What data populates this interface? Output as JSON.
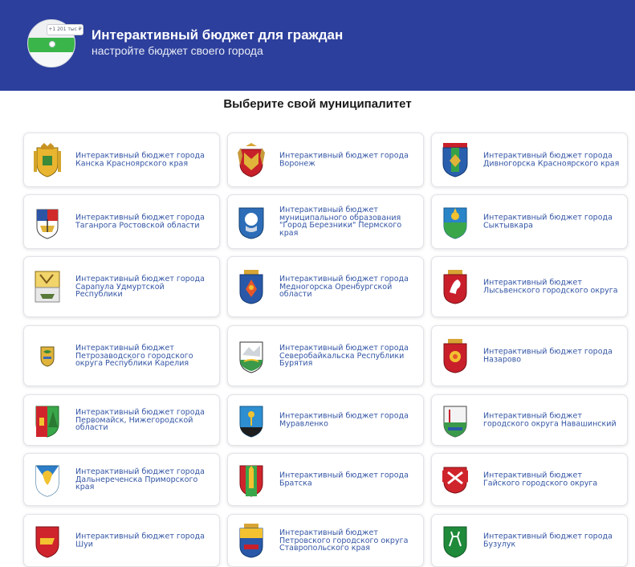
{
  "header": {
    "logo_counter": "+1 201 тыс ₽",
    "title": "Интерактивный бюджет для граждан",
    "subtitle": "настройте бюджет своего города"
  },
  "main": {
    "heading": "Выберите свой муниципалитет",
    "cards": [
      {
        "label": "Интерактивный бюджет города Канска Красноярского края",
        "crest": "kansk-crest-icon"
      },
      {
        "label": "Интерактивный бюджет города Воронеж",
        "crest": "voronezh-crest-icon"
      },
      {
        "label": "Интерактивный бюджет города Дивногорска Красноярского края",
        "crest": "divnogorsk-crest-icon"
      },
      {
        "label": "Интерактивный бюджет города Таганрога Ростовской области",
        "crest": "taganrog-crest-icon"
      },
      {
        "label": "Интерактивный бюджет муниципального образования \"Город Березники\" Пермского края",
        "crest": "berezniki-crest-icon"
      },
      {
        "label": "Интерактивный бюджет города Сыктывкара",
        "crest": "syktyvkar-crest-icon"
      },
      {
        "label": "Интерактивный бюджет города Сарапула Удмуртской Республики",
        "crest": "sarapul-crest-icon"
      },
      {
        "label": "Интерактивный бюджет города Медногорска Оренбургской области",
        "crest": "mednogorsk-crest-icon"
      },
      {
        "label": "Интерактивный бюджет Лысьвенского городского округа",
        "crest": "lysva-crest-icon"
      },
      {
        "label": "Интерактивный бюджет Петрозаводского городского округа Республики Карелия",
        "crest": "petrozavodsk-crest-icon"
      },
      {
        "label": "Интерактивный бюджет города Северобайкальска Республики Бурятия",
        "crest": "severobaikalsk-crest-icon"
      },
      {
        "label": "Интерактивный бюджет города Назарово",
        "crest": "nazarovo-crest-icon"
      },
      {
        "label": "Интерактивный бюджет города Первомайск, Нижегородской области",
        "crest": "pervomaisk-crest-icon"
      },
      {
        "label": "Интерактивный бюджет города Муравленко",
        "crest": "muravlenko-crest-icon"
      },
      {
        "label": "Интерактивный бюджет городского округа Навашинский",
        "crest": "navashino-crest-icon"
      },
      {
        "label": "Интерактивный бюджет города Дальнереченска Приморского края",
        "crest": "dalnerechensk-crest-icon"
      },
      {
        "label": "Интерактивный бюджет города Братска",
        "crest": "bratsk-crest-icon"
      },
      {
        "label": "Интерактивный бюджет Гайского городского округа",
        "crest": "gai-crest-icon"
      },
      {
        "label": "Интерактивный бюджет города Шуи",
        "crest": "shuya-crest-icon"
      },
      {
        "label": "Интерактивный бюджет Петровского городского округа Ставропольского края",
        "crest": "petrovsky-crest-icon"
      },
      {
        "label": "Интерактивный бюджет города Бузулук",
        "crest": "buzuluk-crest-icon"
      }
    ]
  },
  "colors": {
    "header_bg": "#2c3f9c",
    "link": "#3355a4",
    "logo_green": "#3ab54a"
  }
}
